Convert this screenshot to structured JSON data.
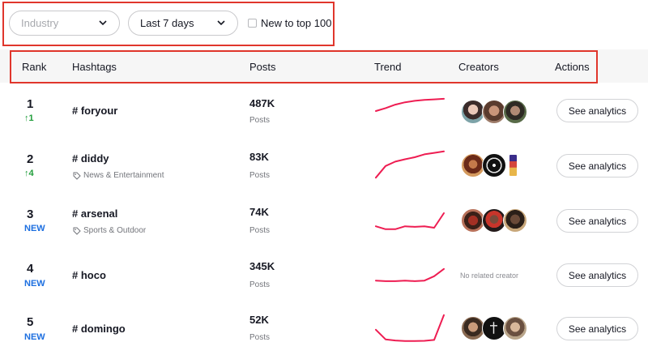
{
  "filters": {
    "industry_placeholder": "Industry",
    "period_value": "Last 7 days",
    "new_checkbox_label": "New to top 100"
  },
  "table": {
    "columns": [
      "Rank",
      "Hashtags",
      "Posts",
      "Trend",
      "Creators",
      "Actions"
    ],
    "rows": [
      {
        "rank": "1",
        "change": "↑1",
        "change_type": "up",
        "hashtag": "# foryour",
        "category": "",
        "posts": "487K",
        "posts_label": "Posts",
        "trend": [
          0.5,
          0.6,
          0.72,
          0.8,
          0.85,
          0.88,
          0.9,
          0.92
        ],
        "creators": [
          "avatar",
          "avatar",
          "avatar"
        ],
        "no_creator_text": "",
        "action": "See analytics"
      },
      {
        "rank": "2",
        "change": "↑4",
        "change_type": "up",
        "hashtag": "# diddy",
        "category": "News & Entertainment",
        "posts": "83K",
        "posts_label": "Posts",
        "trend": [
          0.05,
          0.45,
          0.6,
          0.68,
          0.75,
          0.85,
          0.9,
          0.95
        ],
        "creators": [
          "avatar",
          "avatar",
          "avatar"
        ],
        "no_creator_text": "",
        "action": "See analytics"
      },
      {
        "rank": "3",
        "change": "NEW",
        "change_type": "new",
        "hashtag": "# arsenal",
        "category": "Sports & Outdoor",
        "posts": "74K",
        "posts_label": "Posts",
        "trend": [
          0.3,
          0.2,
          0.2,
          0.3,
          0.28,
          0.3,
          0.25,
          0.75
        ],
        "creators": [
          "avatar",
          "avatar",
          "avatar"
        ],
        "no_creator_text": "",
        "action": "See analytics"
      },
      {
        "rank": "4",
        "change": "NEW",
        "change_type": "new",
        "hashtag": "# hoco",
        "category": "",
        "posts": "345K",
        "posts_label": "Posts",
        "trend": [
          0.3,
          0.28,
          0.28,
          0.3,
          0.28,
          0.3,
          0.45,
          0.7
        ],
        "creators": [],
        "no_creator_text": "No related creator",
        "action": "See analytics"
      },
      {
        "rank": "5",
        "change": "NEW",
        "change_type": "new",
        "hashtag": "# domingo",
        "category": "",
        "posts": "52K",
        "posts_label": "Posts",
        "trend": [
          0.45,
          0.12,
          0.08,
          0.06,
          0.06,
          0.07,
          0.1,
          0.95
        ],
        "creators": [
          "avatar",
          "avatar",
          "avatar"
        ],
        "no_creator_text": "",
        "action": "See analytics"
      }
    ]
  },
  "colors": {
    "trend_line": "#ee1d52",
    "highlight_box": "#e0362c",
    "up": "#1f9d3a",
    "new": "#1d6fe0"
  }
}
